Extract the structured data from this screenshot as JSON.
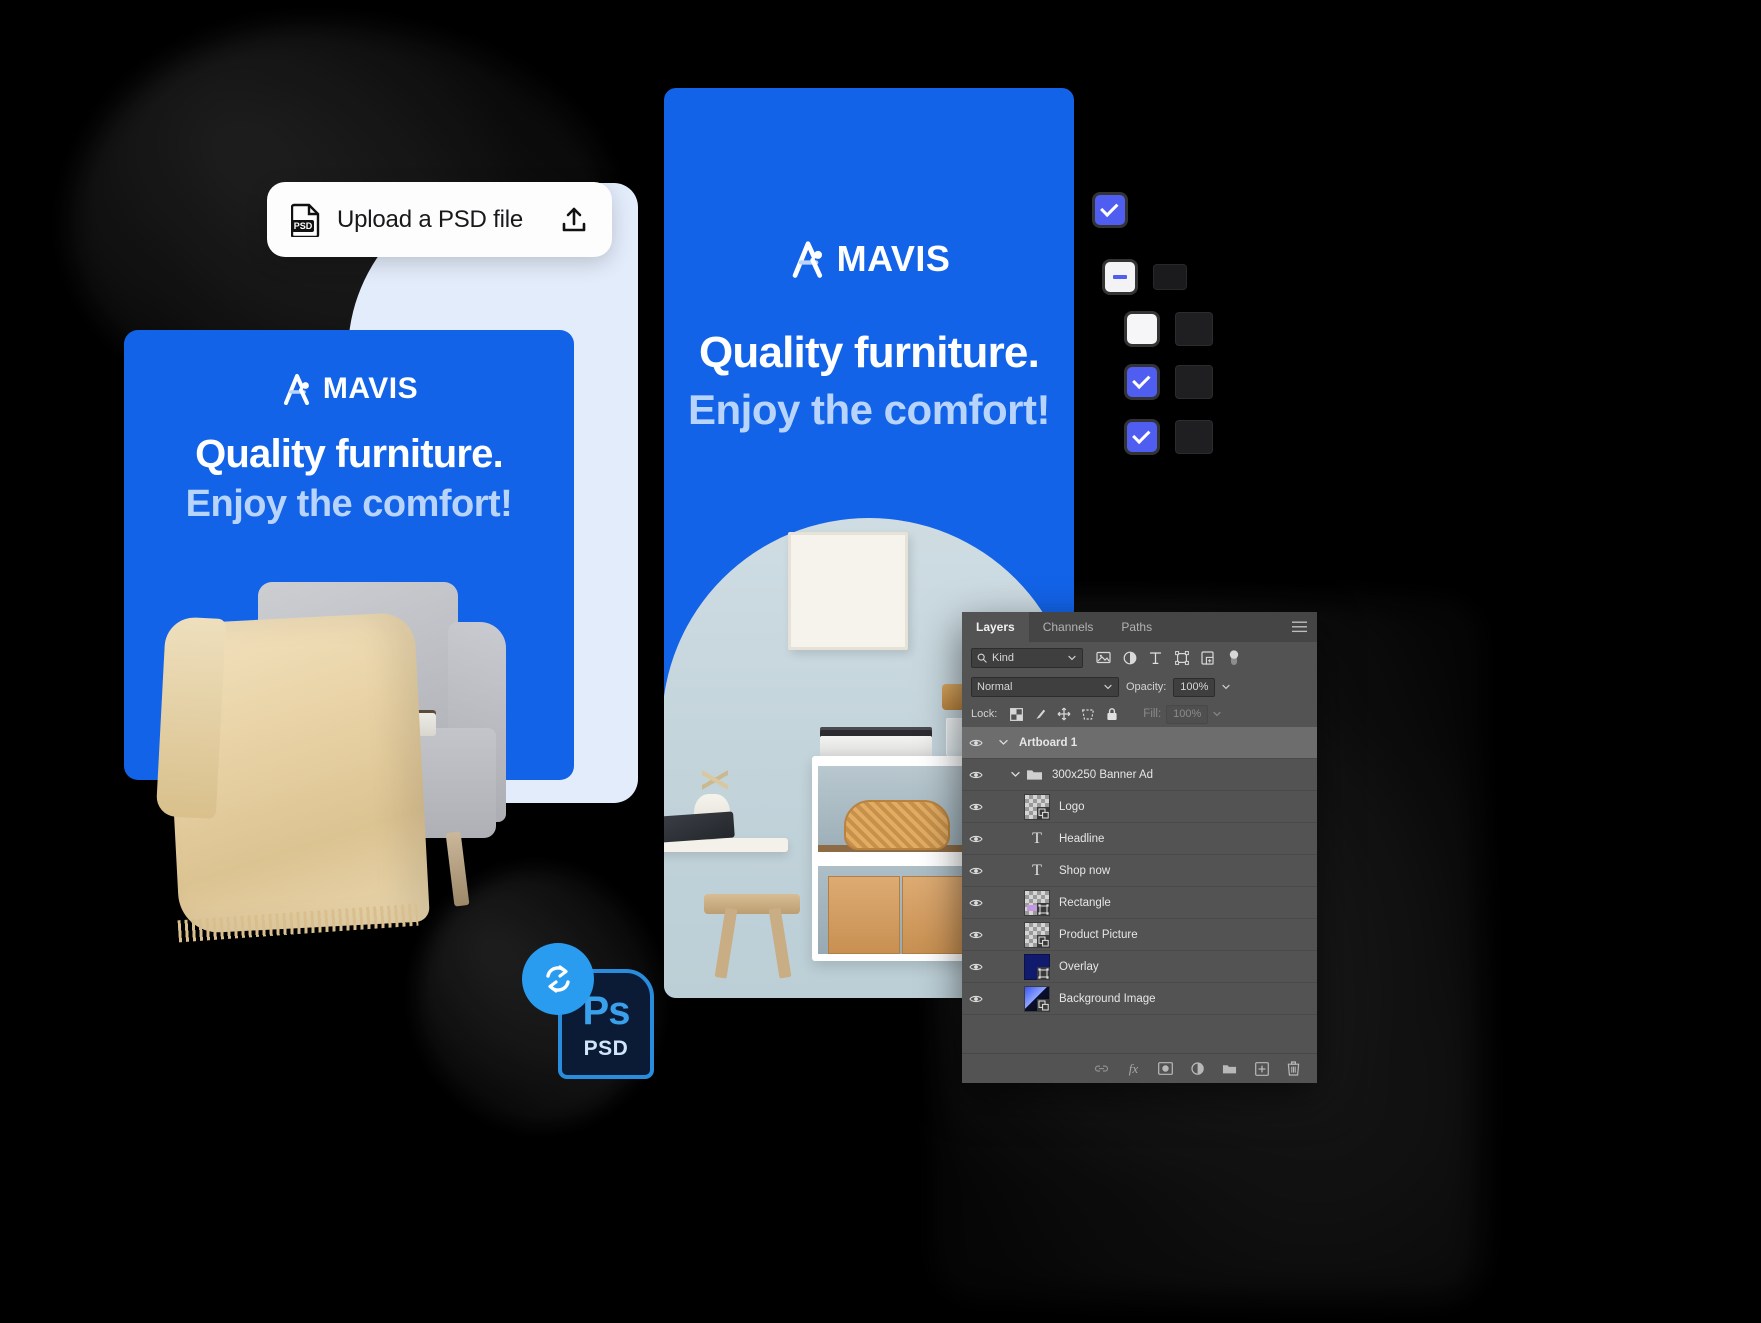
{
  "upload_widget": {
    "label": "Upload a PSD file",
    "file_icon_text": "PSD",
    "file_icon_name": "psd-file-icon",
    "upload_icon_name": "upload-arrow-icon"
  },
  "brand": {
    "name": "MAVIS",
    "accent_blue": "#1363e8",
    "headline_blue": "#b9d4fb"
  },
  "banners": [
    {
      "id": "banner-300x250",
      "logo": "MAVIS",
      "headline": "Quality furniture.",
      "subheadline": "Enjoy the comfort!"
    },
    {
      "id": "banner-mobile",
      "logo": "MAVIS",
      "headline": "Quality furniture.",
      "subheadline": "Enjoy the comfort!"
    }
  ],
  "toggle_column": {
    "items": [
      {
        "state": "checked",
        "label": "checkbox-checked"
      },
      {
        "state": "indeterminate",
        "label": "checkbox-indeterminate"
      },
      {
        "state": "unchecked",
        "label": "checkbox-unchecked"
      },
      {
        "state": "checked",
        "label": "checkbox-checked"
      },
      {
        "state": "checked",
        "label": "checkbox-checked"
      }
    ],
    "accent": "#4f5ef0"
  },
  "psd_badge": {
    "app_mark": "Ps",
    "format": "PSD",
    "sync_icon_name": "sync-refresh-icon",
    "border_color": "#2a8cdd",
    "fill_color": "#0b1b35"
  },
  "photoshop_panel": {
    "tabs": [
      {
        "label": "Layers",
        "active": true
      },
      {
        "label": "Channels",
        "active": false
      },
      {
        "label": "Paths",
        "active": false
      }
    ],
    "menu_icon": "panel-menu-icon",
    "filter": {
      "kind_label": "Kind",
      "search_icon": "search-icon",
      "caret_icon": "chevron-down-icon",
      "type_filters": [
        "pixel-layer-filter-icon",
        "adjustment-layer-filter-icon",
        "type-layer-filter-icon",
        "shape-layer-filter-icon",
        "smart-object-filter-icon",
        "filter-toggle-switch"
      ]
    },
    "blend": {
      "mode": "Normal",
      "opacity_label": "Opacity:",
      "opacity_value": "100%"
    },
    "lock": {
      "label": "Lock:",
      "icons": [
        "lock-transparent-pixels-icon",
        "lock-image-pixels-icon",
        "lock-position-icon",
        "lock-artboard-nesting-icon",
        "lock-all-icon"
      ],
      "fill_label": "Fill:",
      "fill_value": "100%"
    },
    "layers": [
      {
        "name": "Artboard 1",
        "type": "artboard",
        "indent": 0,
        "visible": true,
        "selected": true,
        "expanded": true,
        "thumb": "none"
      },
      {
        "name": "300x250 Banner Ad",
        "type": "group",
        "indent": 1,
        "visible": true,
        "selected": false,
        "expanded": true,
        "thumb": "folder"
      },
      {
        "name": "Logo",
        "type": "smart-object",
        "indent": 2,
        "visible": true,
        "selected": false,
        "thumb": "checker-smartobject"
      },
      {
        "name": "Headline",
        "type": "text",
        "indent": 2,
        "visible": true,
        "selected": false,
        "thumb": "type"
      },
      {
        "name": "Shop now",
        "type": "text",
        "indent": 2,
        "visible": true,
        "selected": false,
        "thumb": "type"
      },
      {
        "name": "Rectangle",
        "type": "shape",
        "indent": 2,
        "visible": true,
        "selected": false,
        "thumb": "checker-shape"
      },
      {
        "name": "Product Picture",
        "type": "smart-object",
        "indent": 2,
        "visible": true,
        "selected": false,
        "thumb": "checker-smartobject"
      },
      {
        "name": "Overlay",
        "type": "shape",
        "indent": 2,
        "visible": true,
        "selected": false,
        "thumb": "navy-shape"
      },
      {
        "name": "Background Image",
        "type": "smart-object",
        "indent": 2,
        "visible": true,
        "selected": false,
        "thumb": "gradient-smartobject"
      }
    ],
    "footer_buttons": [
      "link-layers-icon",
      "layer-styles-fx-icon",
      "add-layer-mask-icon",
      "new-adjustment-layer-icon",
      "new-group-icon",
      "new-layer-icon",
      "delete-layer-icon"
    ],
    "footer_fx_label": "fx"
  }
}
